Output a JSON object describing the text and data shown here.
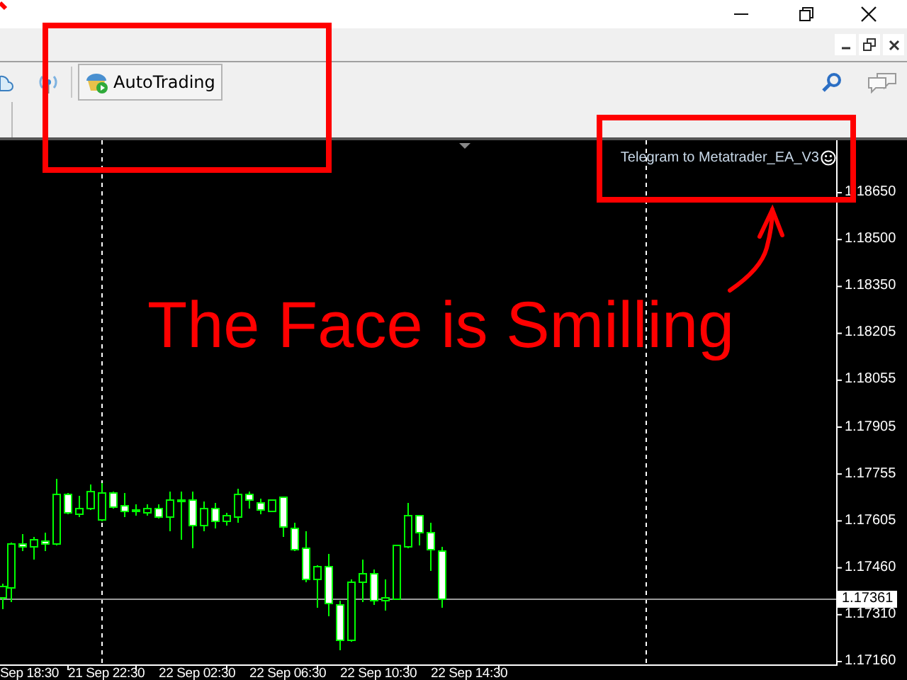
{
  "toolbar": {
    "autotrading_button": {
      "label": "AutoTrading"
    }
  },
  "chart": {
    "indicator_label": "Telegram to Metatrader_EA_V3",
    "price_axis": [
      "1.18650",
      "1.18500",
      "1.18350",
      "1.18205",
      "1.18055",
      "1.17905",
      "1.17755",
      "1.17605",
      "1.17460",
      "1.17310",
      "1.17160"
    ],
    "current_price": "1.17361",
    "time_axis": [
      "Sep 18:30",
      "21 Sep 22:30",
      "22 Sep 02:30",
      "22 Sep 06:30",
      "22 Sep 10:30",
      "22 Sep 14:30"
    ]
  },
  "annotation": {
    "caption": "The Face is Smilling"
  }
}
